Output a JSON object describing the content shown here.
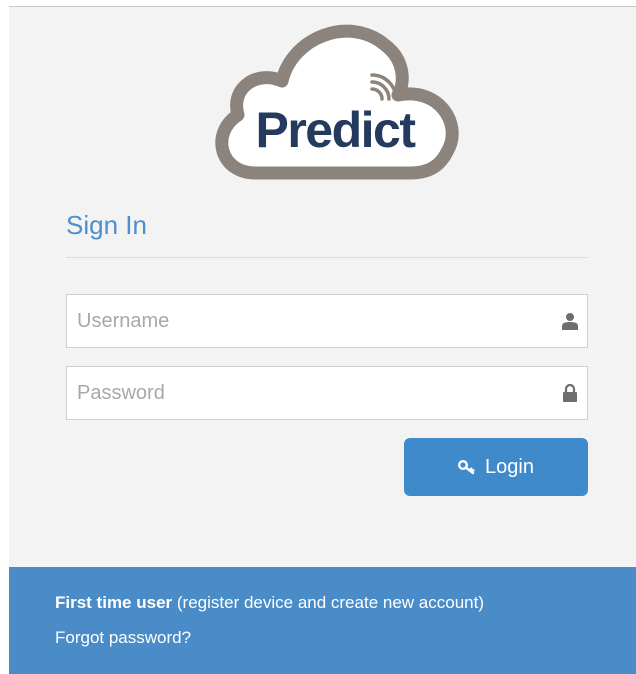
{
  "logo": {
    "text": "Predict"
  },
  "signin": {
    "title": "Sign In"
  },
  "form": {
    "username": {
      "value": "",
      "placeholder": "Username",
      "icon": "user-icon"
    },
    "password": {
      "value": "",
      "placeholder": "Password",
      "icon": "lock-icon"
    },
    "login_label": "Login",
    "login_icon": "key-icon"
  },
  "footer": {
    "first_time_bold": "First time user",
    "first_time_rest": " (register device and create new account)",
    "forgot": "Forgot password?"
  },
  "colors": {
    "accent": "#4a90cf",
    "button": "#3f8acb",
    "footer": "#4a8cc7",
    "logo_text": "#243a5e",
    "cloud_outline": "#8c847c"
  }
}
